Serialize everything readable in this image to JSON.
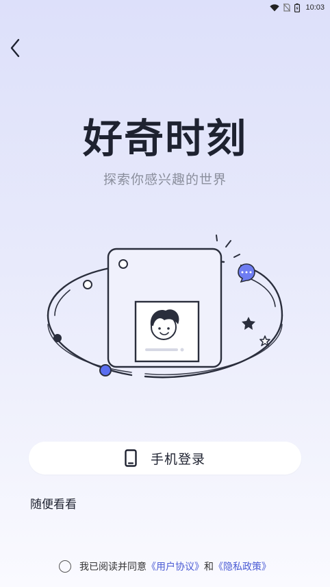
{
  "status_bar": {
    "time": "10:03",
    "icons": [
      "wifi-icon",
      "no-sim-icon",
      "battery-icon"
    ]
  },
  "header": {
    "back_icon": "chevron-left-icon"
  },
  "hero": {
    "title": "好奇时刻",
    "subtitle": "探索你感兴趣的世界",
    "illustration": "avatar-orbit-illustration"
  },
  "actions": {
    "phone_login_icon": "phone-icon",
    "phone_login_label": "手机登录",
    "browse_label": "随便看看"
  },
  "agreement": {
    "prefix": "我已阅读并同意",
    "user_agreement": "《用户协议》",
    "conjunction": "和",
    "privacy_policy": "《隐私政策》",
    "checked": false
  },
  "colors": {
    "accent": "#5a6ef0",
    "text": "#1e2230",
    "subtitle": "#8a8e9c",
    "link": "#4a5bd4"
  }
}
